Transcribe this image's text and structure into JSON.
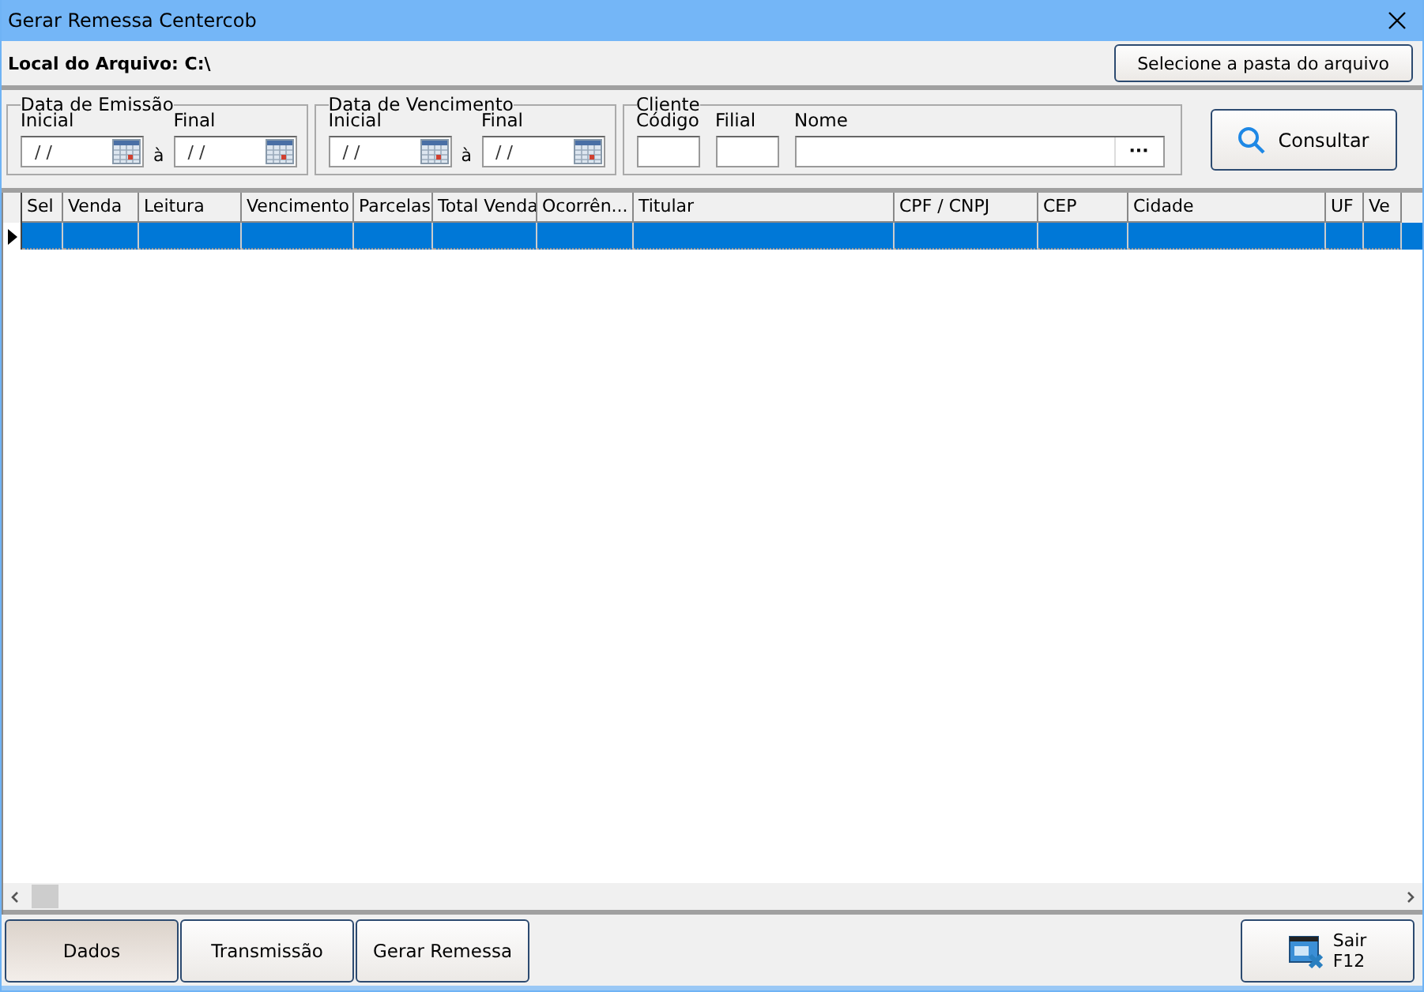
{
  "window": {
    "title": "Gerar Remessa Centercob"
  },
  "file_location": {
    "label": "Local do Arquivo: C:\\",
    "button": "Selecione a pasta do arquivo"
  },
  "filters": {
    "emission": {
      "title": "Data de Emissão",
      "start_label": "Inicial",
      "end_label": "Final",
      "separator": "à",
      "start_value": "/ /",
      "end_value": "/ /"
    },
    "due": {
      "title": "Data de Vencimento",
      "start_label": "Inicial",
      "end_label": "Final",
      "separator": "à",
      "start_value": "/ /",
      "end_value": "/ /"
    },
    "client": {
      "title": "Cliente",
      "code_label": "Código",
      "branch_label": "Filial",
      "name_label": "Nome",
      "ellipsis": "···"
    },
    "search_button": "Consultar"
  },
  "table": {
    "columns": [
      "Sel",
      "Venda",
      "Leitura",
      "Vencimento",
      "Parcelas",
      "Total Venda",
      "Ocorrên...",
      "Titular",
      "CPF / CNPJ",
      "CEP",
      "Cidade",
      "UF",
      "Ve"
    ],
    "rows": [
      {
        "selected": true
      }
    ]
  },
  "bottom_tabs": [
    {
      "label": "Dados",
      "selected": true
    },
    {
      "label": "Transmissão",
      "selected": false
    },
    {
      "label": "Gerar Remessa",
      "selected": false
    }
  ],
  "exit_button": {
    "label": "Sair",
    "shortcut": "F12"
  }
}
